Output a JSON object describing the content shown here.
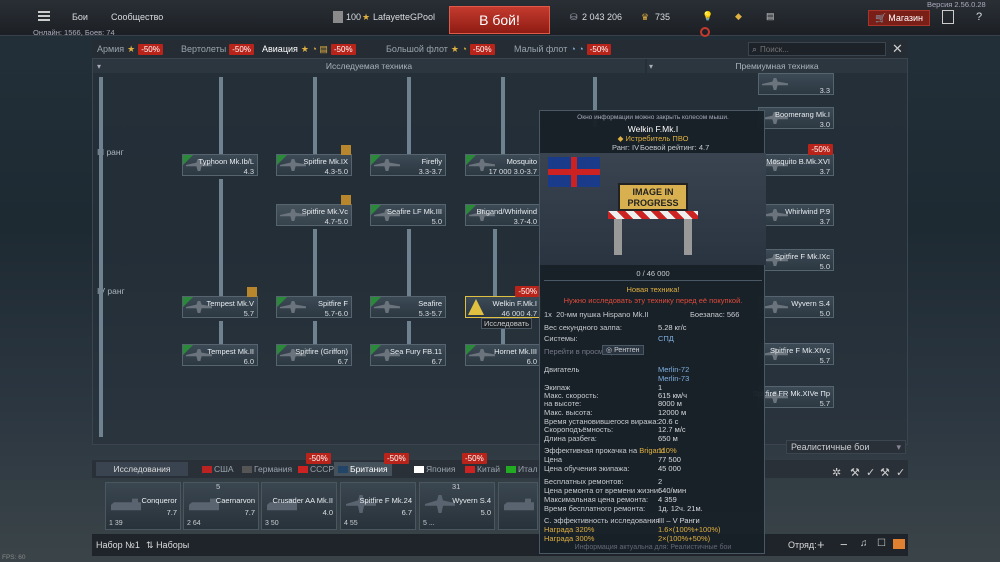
{
  "topbar": {
    "battles": "Бои",
    "community": "Сообщество",
    "level": "100",
    "username": "LafayetteGPool",
    "battle_button": "В бой!",
    "silver": "2 043 206",
    "gold": "735",
    "shop": "Магазин",
    "version": "Версия 2.56.0.28",
    "online": "Онлайн: 1566, Боев: 74",
    "help": "?"
  },
  "tabs": {
    "army": "Армия",
    "army_disc": "-50%",
    "helis": "Вертолеты",
    "helis_disc": "-50%",
    "aviation": "Авиация",
    "aviation_disc": "-50%",
    "bigfleet": "Большой флот",
    "bigfleet_disc": "-50%",
    "smallfleet": "Малый флот",
    "smallfleet_disc": "-50%",
    "search_placeholder": "Поиск..."
  },
  "tree": {
    "researched_header": "Исследуемая техника",
    "premium_header": "Премиумная техника",
    "rank3": "III ранг",
    "rank4": "IV ранг",
    "cards": [
      {
        "name": "Typhoon Mk.Ib/L",
        "br": "4.3"
      },
      {
        "name": "Spitfire Mk.IX",
        "br": "4.3-5.0"
      },
      {
        "name": "Firefly",
        "br": "3.3-3.7"
      },
      {
        "name": "Mosquito",
        "br": "17 000 3.0-3.7"
      },
      {
        "name": "Spitfire Mk.Vc",
        "br": "4.7-5.0"
      },
      {
        "name": "Seafire LF Mk.III",
        "br": "5.0"
      },
      {
        "name": "Brigand/Whirlwind",
        "br": "3.7-4.0"
      },
      {
        "name": "Tempest Mk.V",
        "br": "5.7"
      },
      {
        "name": "Spitfire F",
        "br": "5.7-6.0"
      },
      {
        "name": "Seafire",
        "br": "5.3-5.7"
      },
      {
        "name": "Welkin F.Mk.I",
        "br": "46 000 4.7"
      },
      {
        "name": "Tempest Mk.II",
        "br": "6.0"
      },
      {
        "name": "Spitfire (Griffon)",
        "br": "6.7"
      },
      {
        "name": "Sea Fury FB.11",
        "br": "6.7"
      },
      {
        "name": "Hornet Mk.III",
        "br": "6.0"
      }
    ],
    "premium": [
      {
        "name": "",
        "br": "3.3"
      },
      {
        "name": "",
        "br": "2.7"
      },
      {
        "name": "Boomerang Mk.I",
        "br": "3.0"
      },
      {
        "name": "Mosquito B.Mk.XVI",
        "br": "3.7"
      },
      {
        "name": "Whirlwind P.9",
        "br": "3.7"
      },
      {
        "name": "Spitfire F Mk.IXc",
        "br": "5.0"
      },
      {
        "name": "Wyvern S.4",
        "br": "5.0"
      },
      {
        "name": "Spitfire F Mk.XIVc",
        "br": "5.7"
      },
      {
        "name": "Spitfire FR Mk.XIVe Пр",
        "br": "5.7"
      }
    ],
    "welkin_disc": "-50%",
    "premium_disc": "-50%",
    "research_label": "Исследовать"
  },
  "popup": {
    "hint": "Окно информации можно закрыть колесом мыши.",
    "name": "Welkin F.Mk.I",
    "role": "Истребитель ПВО",
    "rank_label": "Ранг:",
    "rank": "IV",
    "br_label": "Боевой рейтинг:",
    "br": "4.7",
    "image_text": "IMAGE IN PROGRESS",
    "research": "0 / 46 000",
    "new": "Новая техника!",
    "need_research": "Нужно исследовать эту технику перед её покупкой.",
    "weapon_count": "1x",
    "weapon": "20-мм пушка Hispano Mk.II",
    "ammo_label": "Боезапас:",
    "ammo": "566",
    "rows": [
      {
        "k": "Вес секундного залпа:",
        "v": "5.28 кг/с"
      },
      {
        "k": "Системы:",
        "v": "СПД"
      },
      {
        "k": "Двигатель",
        "v": "Merlin-72"
      },
      {
        "k": "",
        "v": "Merlin-73"
      },
      {
        "k": "Экипаж",
        "v": "1"
      },
      {
        "k": "Макс. скорость:",
        "v": "615 км/ч"
      },
      {
        "k": "на высоте:",
        "v": "8000 м"
      },
      {
        "k": "Макс. высота:",
        "v": "12000 м"
      },
      {
        "k": "Время установившегося виража:",
        "v": "20.6 с"
      },
      {
        "k": "Скороподъёмность:",
        "v": "12.7 м/с"
      },
      {
        "k": "Длина разбега:",
        "v": "650 м"
      }
    ],
    "xray_label": "Рентген",
    "xray_hint": "Перейти в просмотр",
    "research_line_k": "Эффективная прокачка на",
    "research_line_nation": "Brigand",
    "research_line_v": "110%",
    "price_k": "Цена",
    "price_v": "77 500",
    "train_k": "Цена обучения экипажа:",
    "train_v": "45 000",
    "free_k": "Бесплатных ремонтов:",
    "free_v": "2",
    "repair_per_k": "Цена ремонта от времени жизни:",
    "repair_per_v": "640/мин",
    "repair_max_k": "Максимальная цена ремонта:",
    "repair_max_v": "4 359",
    "repair_time_k": "Время бесплатного ремонта:",
    "repair_time_v": "1д. 12ч. 21м.",
    "eff_k": "С. эффективность исследования",
    "eff_v": "III – V Ранги",
    "reward1_k": "Награда 320%",
    "reward1_v": "1.6×(100%+100%)",
    "reward2_k": "Награда 300%",
    "reward2_v": "2×(100%+50%)",
    "footer": "Информация актуальна для: Реалистичные бои"
  },
  "mode": {
    "select": "Реалистичные бои"
  },
  "bottom": {
    "crew_tab": "Исследования",
    "nations": [
      {
        "name": "США",
        "disc": "-50%"
      },
      {
        "name": "Германия",
        "disc": "-50%"
      },
      {
        "name": "СССР",
        "disc": "-50%"
      },
      {
        "name": "Британия",
        "disc": ""
      },
      {
        "name": "Япония",
        "disc": "-50%"
      },
      {
        "name": "Китай",
        "disc": "-50%"
      },
      {
        "name": "Итал",
        "disc": ""
      }
    ],
    "crew": [
      {
        "name": "Conqueror",
        "br": "7.7",
        "ft": "1  39"
      },
      {
        "name": "Caernarvon",
        "br": "7.7",
        "ft": "2  64"
      },
      {
        "name": "Crusader AA Mk.II",
        "br": "4.0",
        "ft": "3  50"
      },
      {
        "name": "Spitfire F Mk.24",
        "br": "6.7",
        "ft": "4  55"
      },
      {
        "name": "Wyvern S.4",
        "br": "5.0",
        "ft": "5  ..."
      },
      {
        "name": "",
        "br": "",
        "ft": ""
      }
    ],
    "counts": [
      "5",
      "31"
    ]
  },
  "footer": {
    "preset": "Набор №1",
    "presets": "Наборы",
    "squad": "Отряд:",
    "fps": "FPS: 60"
  }
}
